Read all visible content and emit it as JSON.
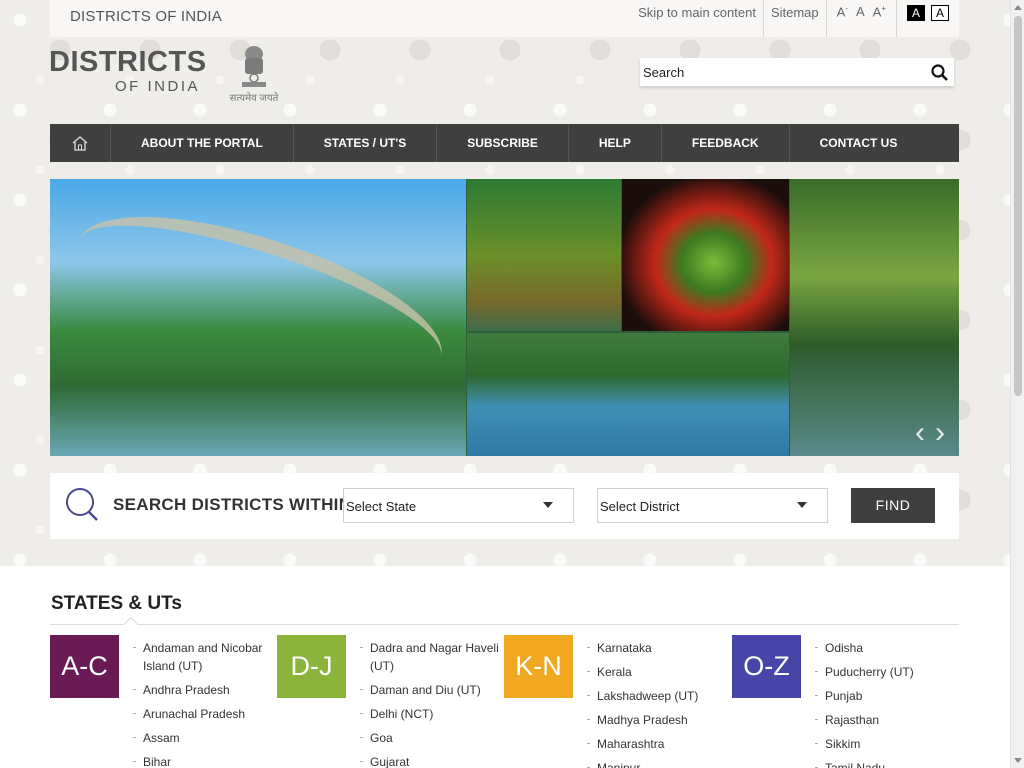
{
  "topbar": {
    "site_label": "DISTRICTS OF INDIA",
    "skip_link": "Skip to main content",
    "sitemap": "Sitemap",
    "font_small": "A",
    "font_small_sup": "-",
    "font_normal": "A",
    "font_large": "A",
    "font_large_sup": "+",
    "contrast_dark": "A",
    "contrast_light": "A"
  },
  "logo": {
    "main": "DISTRICTS",
    "sub": "OF INDIA",
    "emblem_text": "सत्यमेव जयते"
  },
  "search": {
    "placeholder": "Search"
  },
  "nav": {
    "home_icon": "home-icon",
    "items": [
      {
        "label": "ABOUT THE PORTAL"
      },
      {
        "label": "STATES / UT'S"
      },
      {
        "label": "SUBSCRIBE"
      },
      {
        "label": "HELP"
      },
      {
        "label": "FEEDBACK"
      },
      {
        "label": "CONTACT US"
      }
    ]
  },
  "banner": {
    "prev_arrow": "‹",
    "next_arrow": "›"
  },
  "district_search": {
    "title": "SEARCH DISTRICTS WITHIN",
    "state_select": "Select State",
    "district_select": "Select District",
    "find_button": "FIND"
  },
  "states": {
    "title": "STATES & UTs",
    "groups": [
      {
        "tile": "A-C",
        "color": "#6a1b56",
        "items": [
          "Andaman and Nicobar Island (UT)",
          "Andhra Pradesh",
          "Arunachal Pradesh",
          "Assam",
          "Bihar"
        ]
      },
      {
        "tile": "D-J",
        "color": "#8ab43a",
        "items": [
          "Dadra and Nagar Haveli (UT)",
          "Daman and Diu (UT)",
          "Delhi (NCT)",
          "Goa",
          "Gujarat"
        ]
      },
      {
        "tile": "K-N",
        "color": "#f0a820",
        "items": [
          "Karnataka",
          "Kerala",
          "Lakshadweep (UT)",
          "Madhya Pradesh",
          "Maharashtra",
          "Manipur"
        ]
      },
      {
        "tile": "O-Z",
        "color": "#4746a8",
        "items": [
          "Odisha",
          "Puducherry (UT)",
          "Punjab",
          "Rajasthan",
          "Sikkim",
          "Tamil Nadu"
        ]
      }
    ]
  }
}
